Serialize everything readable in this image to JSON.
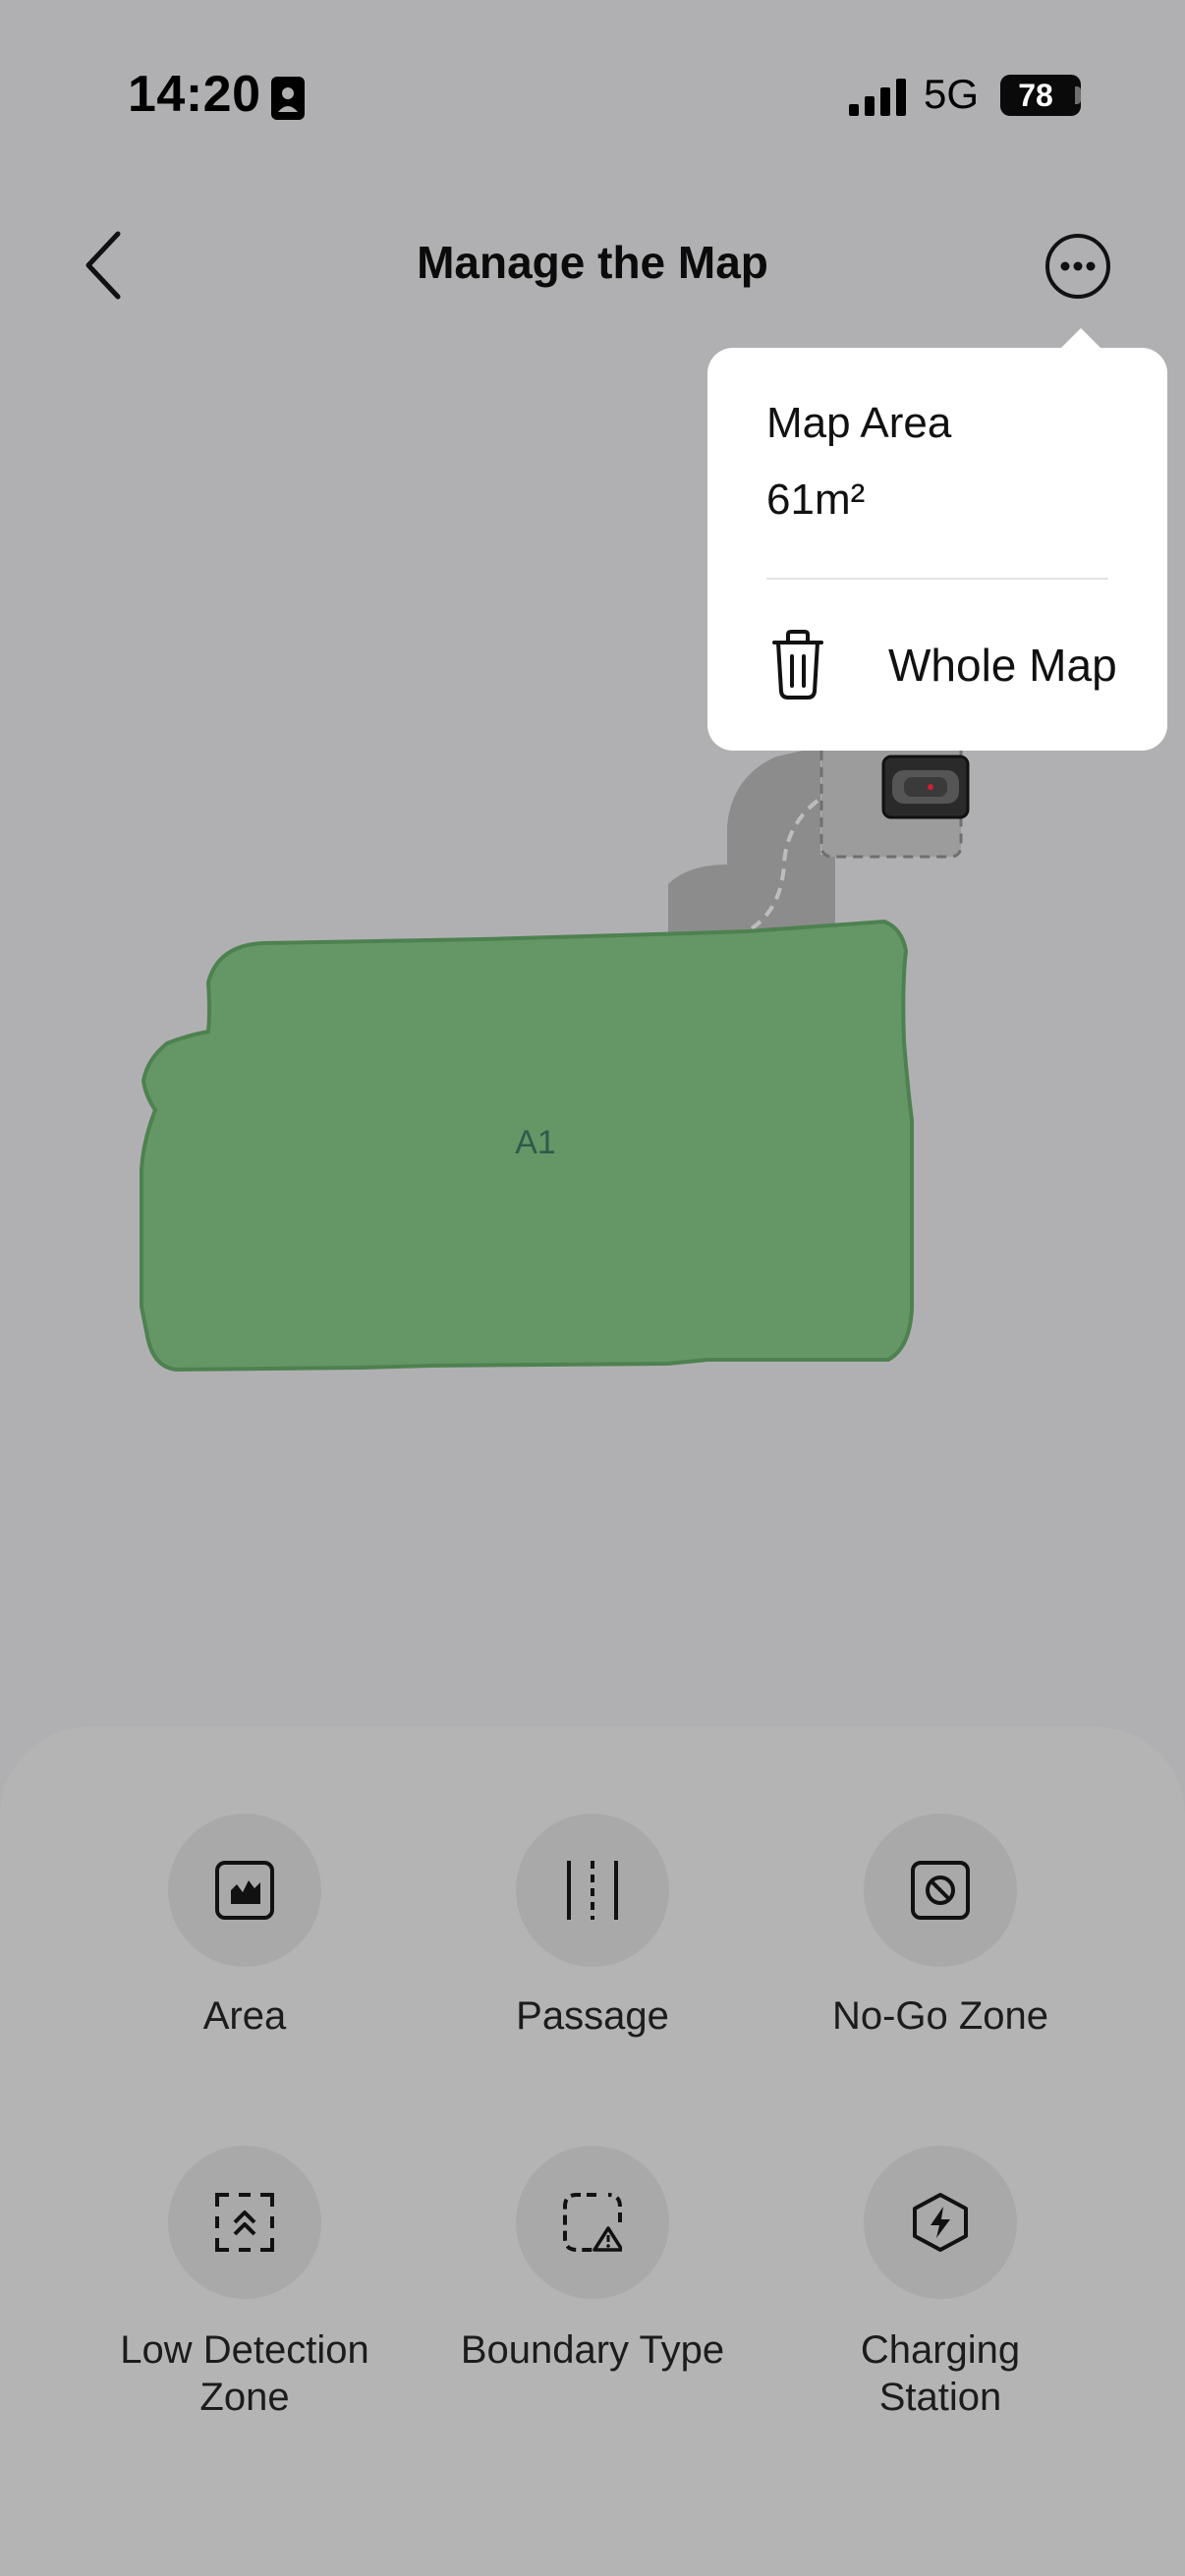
{
  "status_bar": {
    "time": "14:20",
    "network": "5G",
    "battery": "78"
  },
  "header": {
    "title": "Manage the Map",
    "back_icon": "chevron-left-icon",
    "more_icon": "more-horizontal-icon"
  },
  "map": {
    "area_label": "A1",
    "area_color": "#659666"
  },
  "popup": {
    "label": "Map Area",
    "value": "61m²",
    "delete_label": "Whole Map",
    "delete_icon": "trash-icon"
  },
  "tools": [
    {
      "label": "Area",
      "icon": "area-icon"
    },
    {
      "label": "Passage",
      "icon": "passage-icon"
    },
    {
      "label": "No-Go Zone",
      "icon": "no-go-zone-icon"
    },
    {
      "label": "Low Detection Zone",
      "icon": "low-detection-zone-icon"
    },
    {
      "label": "Boundary Type",
      "icon": "boundary-type-icon"
    },
    {
      "label": "Charging Station",
      "icon": "charging-station-icon"
    }
  ]
}
